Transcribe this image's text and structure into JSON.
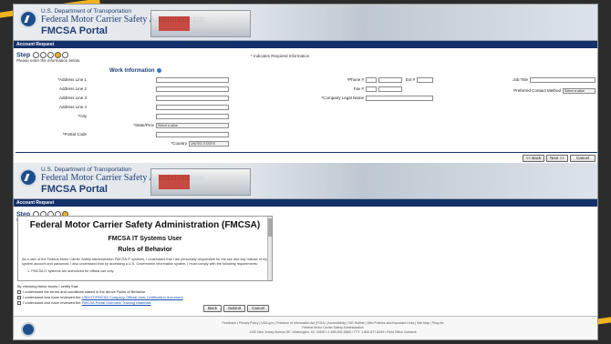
{
  "top": {
    "agency": "U.S. Department of Transportation",
    "admin": "Federal Motor Carrier Safety Administration",
    "portal": "FMCSA Portal",
    "bar_title": "Account Request",
    "step_label": "Step",
    "instruction": "Please enter the information below",
    "required_note": "* Indicates Required Information",
    "section_title": "Work Information",
    "fields_left": [
      "*Address Line 1",
      "Address Line 2",
      "Address Line 3",
      "Address Line 4",
      "*City"
    ],
    "state_label": "*State/Prov",
    "state_value": "Select a value",
    "postal_label": "*Postal Code",
    "country_label": "*Country",
    "country_value": "UNITED STATES",
    "phone_label": "*Phone #",
    "ext_label": "Ext #",
    "fax_label": "Fax #",
    "company_label": "*Company Legal Name",
    "job_title_label": "Job Title",
    "contact_label": "Preferred Contact Method",
    "contact_value": "Select a value",
    "back": "<< Back",
    "next": "Next >>",
    "cancel": "Cancel"
  },
  "bottom": {
    "agency": "U.S. Department of Transportation",
    "admin": "Federal Motor Carrier Safety Administration",
    "portal": "FMCSA Portal",
    "bar_title": "Account Request",
    "step_label": "Step",
    "rules_label": "Rules of Behavior",
    "doc_title": "Federal Motor Carrier Safety Administration (FMCSA)",
    "doc_sub": "FMCSA IT Systems User",
    "doc_rules": "Rules of Behavior",
    "doc_para": "As a user of the Federal Motor Carrier Safety Administration FMCSA IT systems, I understand that I am personally responsible for the use and any misuse of my system account and password. I also understand that by accessing a U.S. Government information system, I must comply with the following requirements:",
    "doc_item": "1. FMCSA IT systems are authorized for official use only.",
    "certify": "By checking these boxes I certify that:",
    "check1": "I understand the terms and conditions stated in the above Rules of Behavior",
    "check2_pre": "I understand and have reviewed the ",
    "check2_link": "USDOT/FMCSA Company Official User Certification document",
    "check3_pre": "I understand and have reviewed the ",
    "check3_link": "FMCSA Portal Overview Training Materials",
    "back": "Back",
    "submit": "Submit",
    "cancel": "Cancel"
  },
  "footer": {
    "links": "Feedback | Privacy Policy | USA.gov | Freedom of Information Act (FOIA) | Accessibility | OIG Hotline | Web Policies and Important Links | Site Map | Plug-ins",
    "address1": "Federal Motor Carrier Safety Administration",
    "address2": "1200 New Jersey Avenue SE, Washington, DC 20590 • 1-800-832-5660 • TTY: 1-800-877-8339 • Field Office Contacts"
  }
}
